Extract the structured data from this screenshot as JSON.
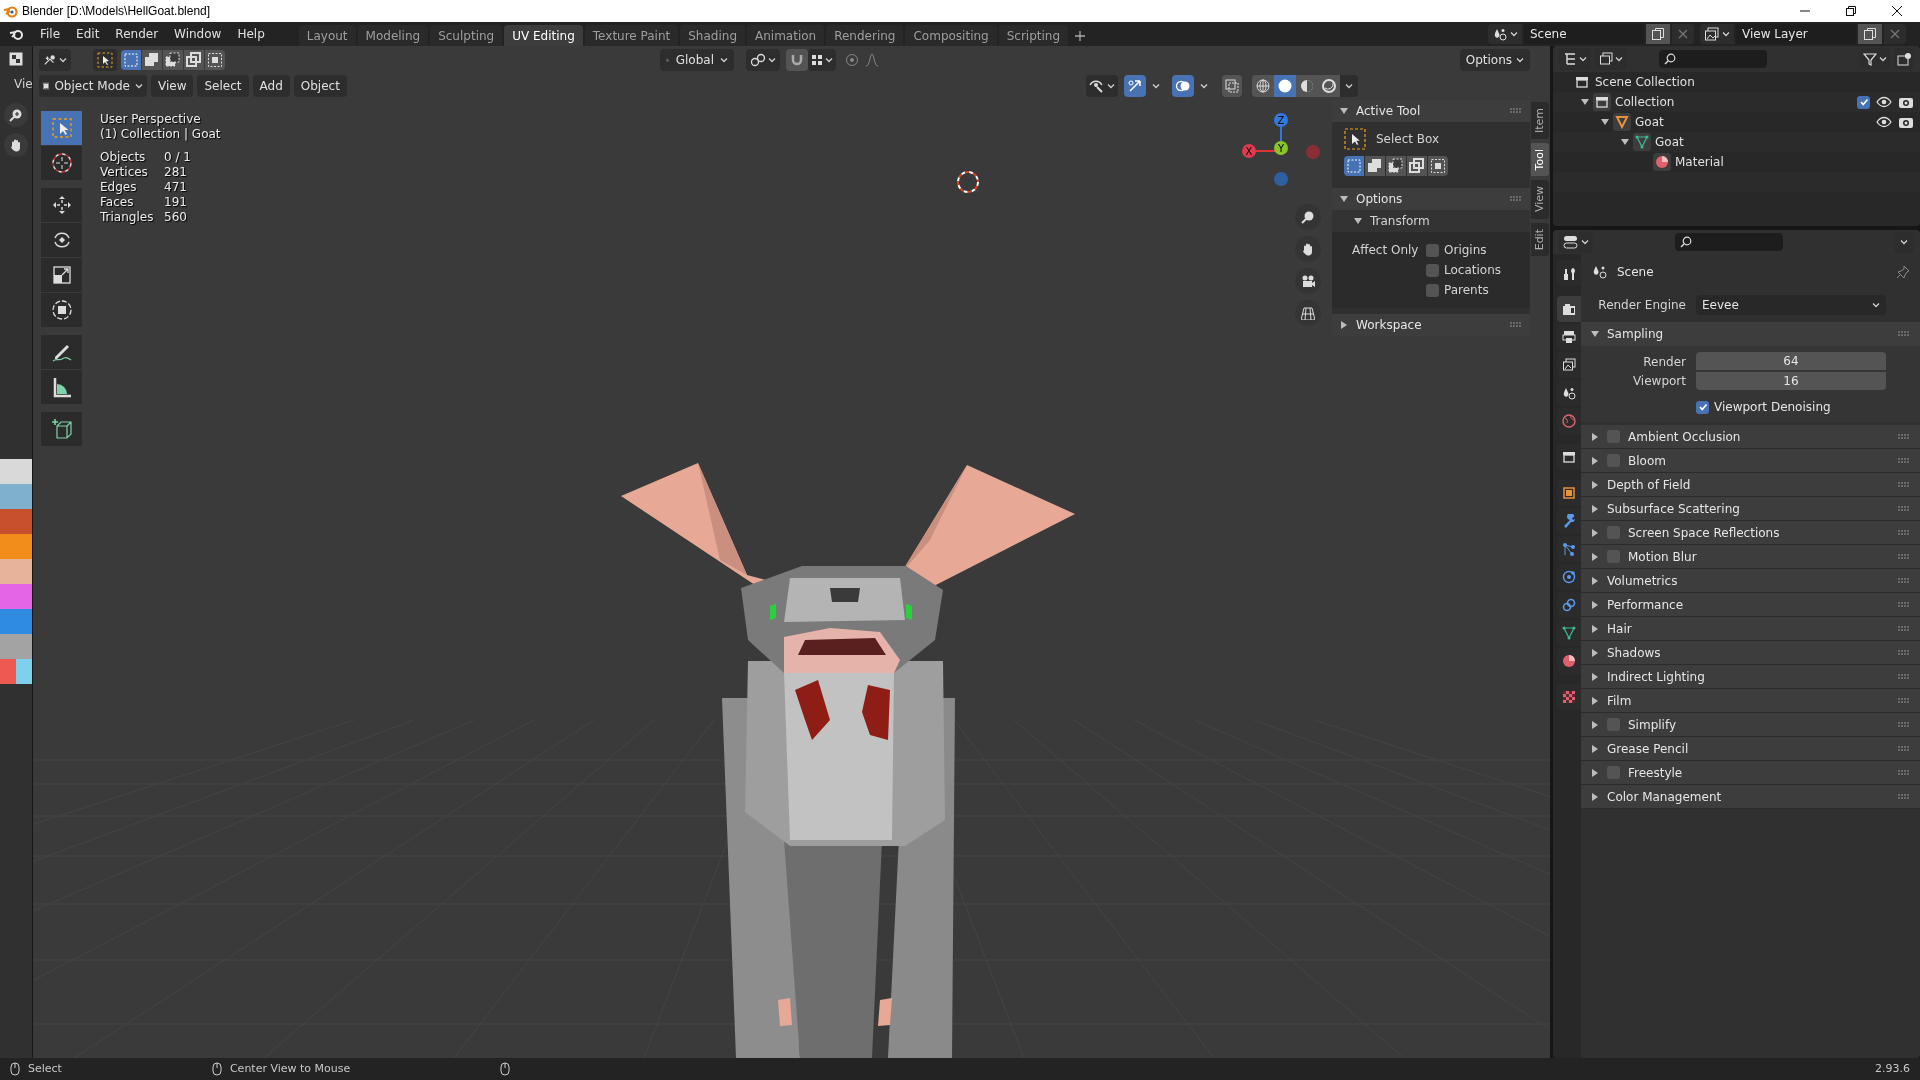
{
  "window": {
    "title": "Blender [D:\\Models\\HellGoat.blend]"
  },
  "menu": [
    "File",
    "Edit",
    "Render",
    "Window",
    "Help"
  ],
  "workspaces": [
    {
      "label": "Layout",
      "selected": false
    },
    {
      "label": "Modeling",
      "selected": false
    },
    {
      "label": "Sculpting",
      "selected": false
    },
    {
      "label": "UV Editing",
      "selected": true
    },
    {
      "label": "Texture Paint",
      "selected": false
    },
    {
      "label": "Shading",
      "selected": false
    },
    {
      "label": "Animation",
      "selected": false
    },
    {
      "label": "Rendering",
      "selected": false
    },
    {
      "label": "Compositing",
      "selected": false
    },
    {
      "label": "Scripting",
      "selected": false
    }
  ],
  "scene": "Scene",
  "view_layer": "View Layer",
  "left_editor": {
    "header_label": "Vie",
    "palette": [
      {
        "color": "#d9d9d9"
      },
      {
        "color": "#d9d9d9"
      },
      {
        "color": "#7fb0cc"
      },
      {
        "color": "#7fb0cc"
      },
      {
        "color": "#c8502c"
      },
      {
        "color": "#c8502c"
      },
      {
        "color": "#f28c1a"
      },
      {
        "color": "#f28c1a"
      },
      {
        "color": "#e8b39b"
      },
      {
        "color": "#e8b39b"
      },
      {
        "color": "#e466e6"
      },
      {
        "color": "#e466e6"
      },
      {
        "color": "#2f8be0"
      },
      {
        "color": "#2f8be0"
      },
      {
        "color": "#a3a3a3"
      },
      {
        "color": "#a3a3a3"
      },
      {
        "color": "#ee5a52"
      },
      {
        "color": "#7fd0ec"
      }
    ]
  },
  "viewport": {
    "select_modes": [
      {
        "selected": true
      },
      {
        "selected": false
      },
      {
        "selected": false
      },
      {
        "selected": false
      },
      {
        "selected": false
      }
    ],
    "orientation": "Global",
    "options": "Options",
    "mode": "Object Mode",
    "header_menus": [
      "View",
      "Select",
      "Add",
      "Object"
    ],
    "shading_modes": [
      {
        "selected": false
      },
      {
        "selected": true
      },
      {
        "selected": false
      },
      {
        "selected": false
      }
    ],
    "gizmos_on": true,
    "overlays_on": true,
    "info": [
      "User Perspective",
      "(1) Collection | Goat"
    ],
    "stats": [
      {
        "label": "Objects",
        "value": "0 / 1"
      },
      {
        "label": "Vertices",
        "value": "281"
      },
      {
        "label": "Edges",
        "value": "471"
      },
      {
        "label": "Faces",
        "value": "191"
      },
      {
        "label": "Triangles",
        "value": "560"
      }
    ],
    "tools": [
      {
        "kind": "select_box",
        "selected": true
      },
      {
        "kind": "cursor",
        "selected": false
      },
      {
        "kind": "move",
        "selected": false
      },
      {
        "kind": "rotate",
        "selected": false
      },
      {
        "kind": "scale",
        "selected": false
      },
      {
        "kind": "transform",
        "selected": false
      },
      {
        "kind": "annotate",
        "selected": false
      },
      {
        "kind": "measure",
        "selected": false
      },
      {
        "kind": "add_cube",
        "selected": false
      }
    ],
    "gizmo_axes": [
      "X",
      "Y",
      "Z"
    ]
  },
  "sidebar": {
    "tabs": [
      {
        "label": "Item",
        "selected": false
      },
      {
        "label": "Tool",
        "selected": true
      },
      {
        "label": "View",
        "selected": false
      },
      {
        "label": "Edit",
        "selected": false
      }
    ],
    "active_tool": {
      "title": "Active Tool",
      "expanded": true,
      "tool": "Select Box",
      "modes": [
        {
          "selected": true
        },
        {
          "selected": false
        },
        {
          "selected": false
        },
        {
          "selected": false
        },
        {
          "selected": false
        }
      ]
    },
    "options": {
      "title": "Options",
      "expanded": true,
      "transform": {
        "title": "Transform",
        "expanded": true,
        "label": "Affect Only",
        "checkboxes": [
          {
            "label": "Origins",
            "checked": false
          },
          {
            "label": "Locations",
            "checked": false
          },
          {
            "label": "Parents",
            "checked": false
          }
        ]
      }
    },
    "workspace": {
      "title": "Workspace",
      "expanded": false
    }
  },
  "outliner": {
    "tree": [
      {
        "label": "Scene Collection",
        "kind": "scene_collection",
        "children": [
          {
            "label": "Collection",
            "kind": "collection",
            "expanded": true,
            "checked": true,
            "children": [
              {
                "label": "Goat",
                "kind": "object",
                "expanded": true,
                "children": [
                  {
                    "label": "Goat",
                    "kind": "mesh",
                    "expanded": true,
                    "children": [
                      {
                        "label": "Material",
                        "kind": "material"
                      }
                    ]
                  }
                ]
              }
            ]
          }
        ]
      }
    ]
  },
  "properties": {
    "tabs": [
      {
        "kind": "tool",
        "selected": false
      },
      {
        "kind": "render",
        "selected": true
      },
      {
        "kind": "output",
        "selected": false
      },
      {
        "kind": "view_layer",
        "selected": false
      },
      {
        "kind": "scene",
        "selected": false
      },
      {
        "kind": "world",
        "selected": false
      },
      {
        "kind": "collection",
        "selected": false
      },
      {
        "kind": "object",
        "selected": false
      },
      {
        "kind": "modifiers",
        "selected": false
      },
      {
        "kind": "particles",
        "selected": false
      },
      {
        "kind": "physics",
        "selected": false
      },
      {
        "kind": "constraints",
        "selected": false
      },
      {
        "kind": "data",
        "selected": false
      },
      {
        "kind": "material",
        "selected": false
      },
      {
        "kind": "texture",
        "selected": false
      }
    ],
    "context": "Scene",
    "render_engine_label": "Render Engine",
    "render_engine": "Eevee",
    "sampling": {
      "title": "Sampling",
      "expanded": true,
      "fields": [
        {
          "label": "Render",
          "value": "64"
        },
        {
          "label": "Viewport",
          "value": "16"
        }
      ],
      "denoising": {
        "label": "Viewport Denoising",
        "checked": true
      }
    },
    "panels": [
      {
        "label": "Ambient Occlusion",
        "kind": "toggle",
        "checked": false,
        "expanded": false
      },
      {
        "label": "Bloom",
        "kind": "toggle",
        "checked": false,
        "expanded": false
      },
      {
        "label": "Depth of Field",
        "kind": "plain",
        "expanded": false
      },
      {
        "label": "Subsurface Scattering",
        "kind": "plain",
        "expanded": false
      },
      {
        "label": "Screen Space Reflections",
        "kind": "toggle",
        "checked": false,
        "expanded": false
      },
      {
        "label": "Motion Blur",
        "kind": "toggle",
        "checked": false,
        "expanded": false
      },
      {
        "label": "Volumetrics",
        "kind": "plain",
        "expanded": false
      },
      {
        "label": "Performance",
        "kind": "plain",
        "expanded": false
      },
      {
        "label": "Hair",
        "kind": "plain",
        "expanded": false
      },
      {
        "label": "Shadows",
        "kind": "plain",
        "expanded": false
      },
      {
        "label": "Indirect Lighting",
        "kind": "plain",
        "expanded": false
      },
      {
        "label": "Film",
        "kind": "plain",
        "expanded": false
      },
      {
        "label": "Simplify",
        "kind": "toggle",
        "checked": false,
        "expanded": false
      },
      {
        "label": "Grease Pencil",
        "kind": "plain",
        "expanded": false
      },
      {
        "label": "Freestyle",
        "kind": "toggle",
        "checked": false,
        "expanded": false
      },
      {
        "label": "Color Management",
        "kind": "plain",
        "expanded": false
      }
    ]
  },
  "status_bar": {
    "hints": [
      "Select",
      "Center View to Mouse"
    ],
    "version": "2.93.6"
  }
}
